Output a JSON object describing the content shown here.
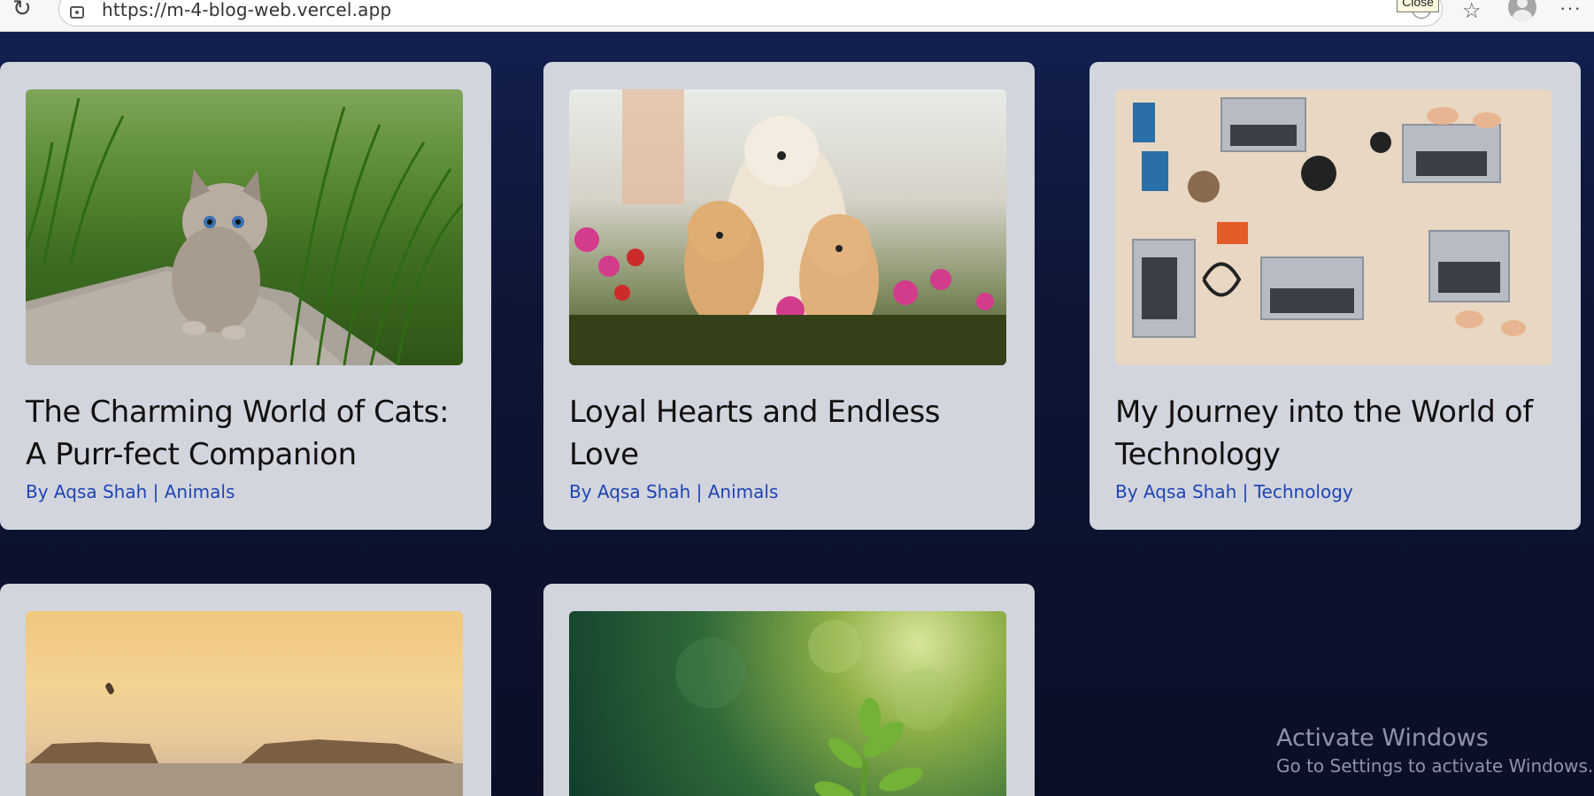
{
  "browser": {
    "url": "https://m-4-blog-web.vercel.app",
    "tooltip": "Close",
    "icons": [
      "reload-icon",
      "site-info-icon",
      "reader-icon",
      "favorites-icon",
      "profile-avatar",
      "more-icon"
    ]
  },
  "posts": [
    {
      "title": "The Charming World of Cats: A Purr-fect Companion",
      "meta": "By Aqsa Shah | Animals",
      "image": "kitten-in-grass"
    },
    {
      "title": "Loyal Hearts and Endless Love",
      "meta": "By Aqsa Shah | Animals",
      "image": "puppies-with-flowers"
    },
    {
      "title": "My Journey into the World of Technology",
      "meta": "By Aqsa Shah | Technology",
      "image": "laptops-on-desk"
    },
    {
      "title": "",
      "meta": "",
      "image": "sunset-seascape"
    },
    {
      "title": "",
      "meta": "",
      "image": "green-plant-sprout"
    }
  ],
  "watermark": {
    "line1": "Activate Windows",
    "line2": "Go to Settings to activate Windows."
  },
  "colors": {
    "background": "#0e1636",
    "card": "#d2d5dd",
    "meta_text": "#1f44b3"
  }
}
